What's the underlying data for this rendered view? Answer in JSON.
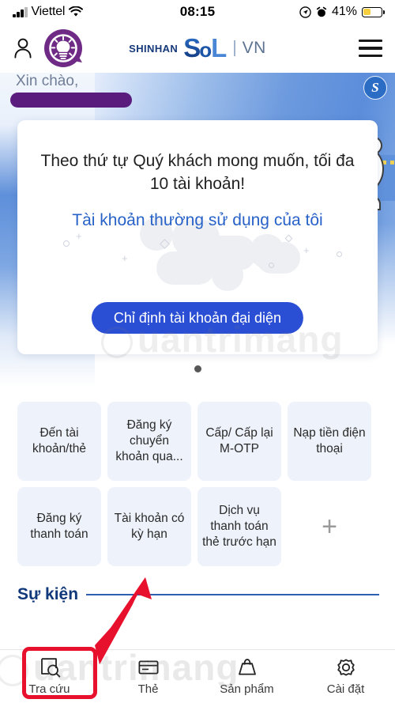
{
  "status_bar": {
    "carrier": "Viettel",
    "wifi_icon": "wifi-icon",
    "time": "08:15",
    "location_icon": "location-arrow-icon",
    "alarm_icon": "alarm-clock-icon",
    "battery_percent": "41%",
    "battery_level": 41,
    "battery_color": "#f6cf3f"
  },
  "header": {
    "profile_icon": "person-icon",
    "tips_logo_icon": "lightbulb-badge-icon",
    "brand": {
      "prefix": "SHINHAN",
      "s": "S",
      "o": "o",
      "l": "L",
      "suffix": "VN"
    },
    "menu_icon": "hamburger-menu-icon"
  },
  "greeting": {
    "hello": "Xin chào,",
    "username_redacted": true,
    "redaction_color": "#5a1d7e"
  },
  "banner": {
    "mascot_icon": "bear-mascot-with-telescope",
    "city_icon": "city-skyline",
    "badge_letter": "S",
    "accent_color": "#5b8ddb"
  },
  "promo_card": {
    "message": "Theo thứ tự Quý khách mong muốn, tối đa 10 tài khoản!",
    "link_label": "Tài khoản thường sử dụng của tôi",
    "link_color": "#2862c8",
    "button_label": "Chỉ định tài khoản đại diện",
    "button_color": "#2b4fd4",
    "pagination_dots": 1,
    "active_dot": 1
  },
  "shortcuts": {
    "tiles": [
      {
        "label": "Đến tài khoản/thẻ"
      },
      {
        "label": "Đăng ký chuyển khoản qua..."
      },
      {
        "label": "Cấp/ Cấp lại M-OTP"
      },
      {
        "label": "Nạp tiền điện thoại"
      },
      {
        "label": "Đăng ký thanh toán"
      },
      {
        "label": "Tài khoản có kỳ hạn"
      },
      {
        "label": "Dịch vụ thanh toán thẻ trước hạn"
      }
    ],
    "add_label": "+",
    "tile_bg": "#eef2fa"
  },
  "events_section": {
    "title": "Sự kiện",
    "rule_color": "#2e5fae"
  },
  "bottom_nav": {
    "items": [
      {
        "label": "Tra cứu",
        "icon": "magnifier-document-icon",
        "highlighted": true
      },
      {
        "label": "Thẻ",
        "icon": "credit-card-icon",
        "highlighted": false
      },
      {
        "label": "Sản phẩm",
        "icon": "shopping-bag-icon",
        "highlighted": false
      },
      {
        "label": "Cài đặt",
        "icon": "gear-icon",
        "highlighted": false
      }
    ]
  },
  "annotations": {
    "arrow_icon": "red-arrow-pointing-down-left",
    "highlight_icon": "red-rectangle-highlight",
    "annotation_color": "#e8112d",
    "highlight_target": "Tra cứu"
  },
  "watermark": {
    "text": "uantrimang",
    "logo_icon": "quantrimang-circle-logo"
  }
}
